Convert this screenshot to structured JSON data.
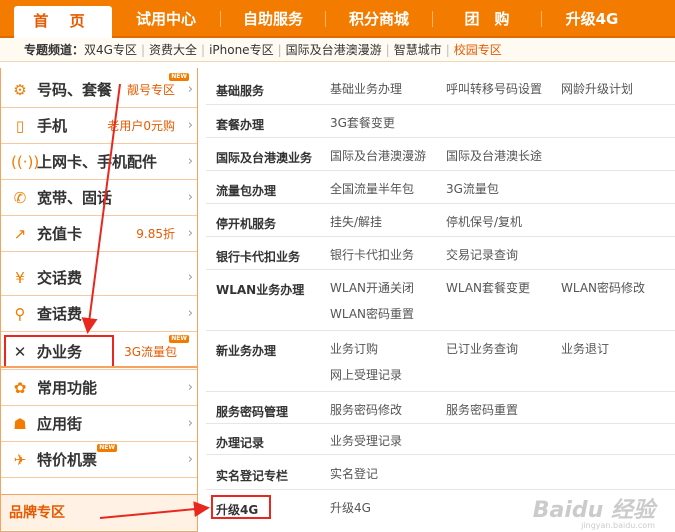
{
  "topnav": {
    "tabs": [
      {
        "label": "首 页",
        "active": true
      },
      {
        "label": "试用中心"
      },
      {
        "label": "自助服务"
      },
      {
        "label": "积分商城"
      },
      {
        "label": "团　购"
      },
      {
        "label": "升级4G"
      }
    ]
  },
  "special": {
    "label": "专题频道：",
    "links": [
      "双4G专区",
      "资费大全",
      "iPhone专区",
      "国际及台港澳漫游",
      "智慧城市",
      "校园专区"
    ]
  },
  "sidebar": {
    "items": [
      {
        "icon": "gear-icon",
        "label": "号码、套餐",
        "promo": "靓号专区",
        "new": "NEW"
      },
      {
        "icon": "phone-icon",
        "label": "手机",
        "promo": "老用户0元购"
      },
      {
        "icon": "signal-icon",
        "label": "上网卡、手机配件"
      },
      {
        "icon": "handset-icon",
        "label": "宽带、固话"
      },
      {
        "icon": "recharge-icon",
        "label": "充值卡",
        "promo": "9.85折"
      },
      {
        "icon": "yen-icon",
        "label": "交话费"
      },
      {
        "icon": "search-icon",
        "label": "查话费"
      },
      {
        "icon": "tools-icon",
        "label": "办业务",
        "promo": "3G流量包",
        "new": "NEW"
      },
      {
        "icon": "star-icon",
        "label": "常用功能"
      },
      {
        "icon": "android-icon",
        "label": "应用街"
      },
      {
        "icon": "plane-icon",
        "label": "特价机票",
        "new": "NEW"
      }
    ],
    "brand": "品牌专区",
    "new_badge": "NEW"
  },
  "services": [
    {
      "cat": "基础服务",
      "links": [
        "基础业务办理",
        "呼叫转移号码设置",
        "网龄升级计划"
      ]
    },
    {
      "cat": "套餐办理",
      "links": [
        "3G套餐变更"
      ]
    },
    {
      "cat": "国际及台港澳业务",
      "links": [
        "国际及台港澳漫游",
        "国际及台港澳长途"
      ]
    },
    {
      "cat": "流量包办理",
      "links": [
        "全国流量半年包",
        "3G流量包"
      ]
    },
    {
      "cat": "停开机服务",
      "links": [
        "挂失/解挂",
        "停机保号/复机"
      ]
    },
    {
      "cat": "银行卡代扣业务",
      "links": [
        "银行卡代扣业务",
        "交易记录查询"
      ]
    },
    {
      "cat": "WLAN业务办理",
      "links": [
        "WLAN开通关闭",
        "WLAN套餐变更",
        "WLAN密码修改",
        "WLAN密码重置"
      ]
    },
    {
      "cat": "新业务办理",
      "links": [
        "业务订购",
        "已订业务查询",
        "业务退订",
        "网上受理记录"
      ]
    },
    {
      "cat": "服务密码管理",
      "links": [
        "服务密码修改",
        "服务密码重置"
      ]
    },
    {
      "cat": "办理记录",
      "links": [
        "业务受理记录"
      ]
    },
    {
      "cat": "实名登记专栏",
      "links": [
        "实名登记"
      ]
    },
    {
      "cat": "升级4G",
      "links": [
        "升级4G"
      ]
    }
  ],
  "watermark": {
    "text": "Baidu 经验",
    "sub": "jingyan.baidu.com"
  },
  "colors": {
    "brand_orange": "#f27b00",
    "highlight_red": "#e8281e"
  }
}
